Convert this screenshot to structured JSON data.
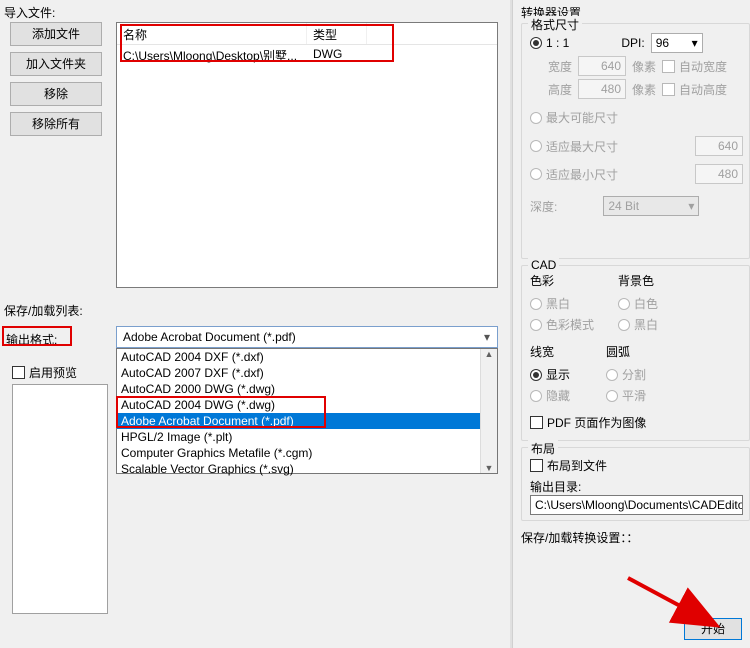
{
  "left": {
    "import_label": "导入文件:",
    "buttons": {
      "add_file": "添加文件",
      "add_folder": "加入文件夹",
      "remove": "移除",
      "remove_all": "移除所有"
    },
    "file_list": {
      "headers": {
        "name": "名称",
        "type": "类型"
      },
      "row": {
        "path": "C:\\Users\\Mloong\\Desktop\\别墅...",
        "type": "DWG"
      }
    },
    "save_list_label": "保存/加载列表:",
    "output_format_label": "输出格式:",
    "dropdown": {
      "selected": "Adobe Acrobat Document (*.pdf)",
      "options": [
        "AutoCAD 2004 DXF (*.dxf)",
        "AutoCAD 2007 DXF (*.dxf)",
        "AutoCAD 2000 DWG (*.dwg)",
        "AutoCAD 2004 DWG (*.dwg)",
        "Adobe Acrobat Document (*.pdf)",
        "HPGL/2 Image (*.plt)",
        "Computer Graphics Metafile (*.cgm)",
        "Scalable Vector Graphics (*.svg)"
      ],
      "selected_index": 4
    },
    "enable_preview": "启用预览"
  },
  "right": {
    "title": "转换器设置",
    "format_size": {
      "legend": "格式尺寸",
      "one_to_one": "1 : 1",
      "dpi_label": "DPI:",
      "dpi_value": "96",
      "width_label": "宽度",
      "width_value": "640",
      "pixels": "像素",
      "auto_width": "自动宽度",
      "height_label": "高度",
      "height_value": "480",
      "auto_height": "自动高度",
      "max_possible": "最大可能尺寸",
      "fit_max": "适应最大尺寸",
      "fit_max_value": "640",
      "fit_min": "适应最小尺寸",
      "fit_min_value": "480",
      "depth_label": "深度:",
      "depth_value": "24 Bit"
    },
    "cad": {
      "legend": "CAD",
      "color_head": "色彩",
      "color_bw": "黑白",
      "color_mode": "色彩模式",
      "bg_head": "背景色",
      "bg_white": "白色",
      "bg_black": "黑白",
      "lw_head": "线宽",
      "lw_show": "显示",
      "lw_hide": "隐藏",
      "arc_head": "圆弧",
      "arc_split": "分割",
      "arc_smooth": "平滑",
      "pdf_as_image": "PDF 页面作为图像"
    },
    "layout": {
      "legend": "布局",
      "to_file": "布局到文件",
      "out_dir_label": "输出目录:",
      "out_dir_value": "C:\\Users\\Mloong\\Documents\\CADEditor"
    },
    "save_conv_label": "保存/加载转换设置：：",
    "start_button": "开始"
  }
}
